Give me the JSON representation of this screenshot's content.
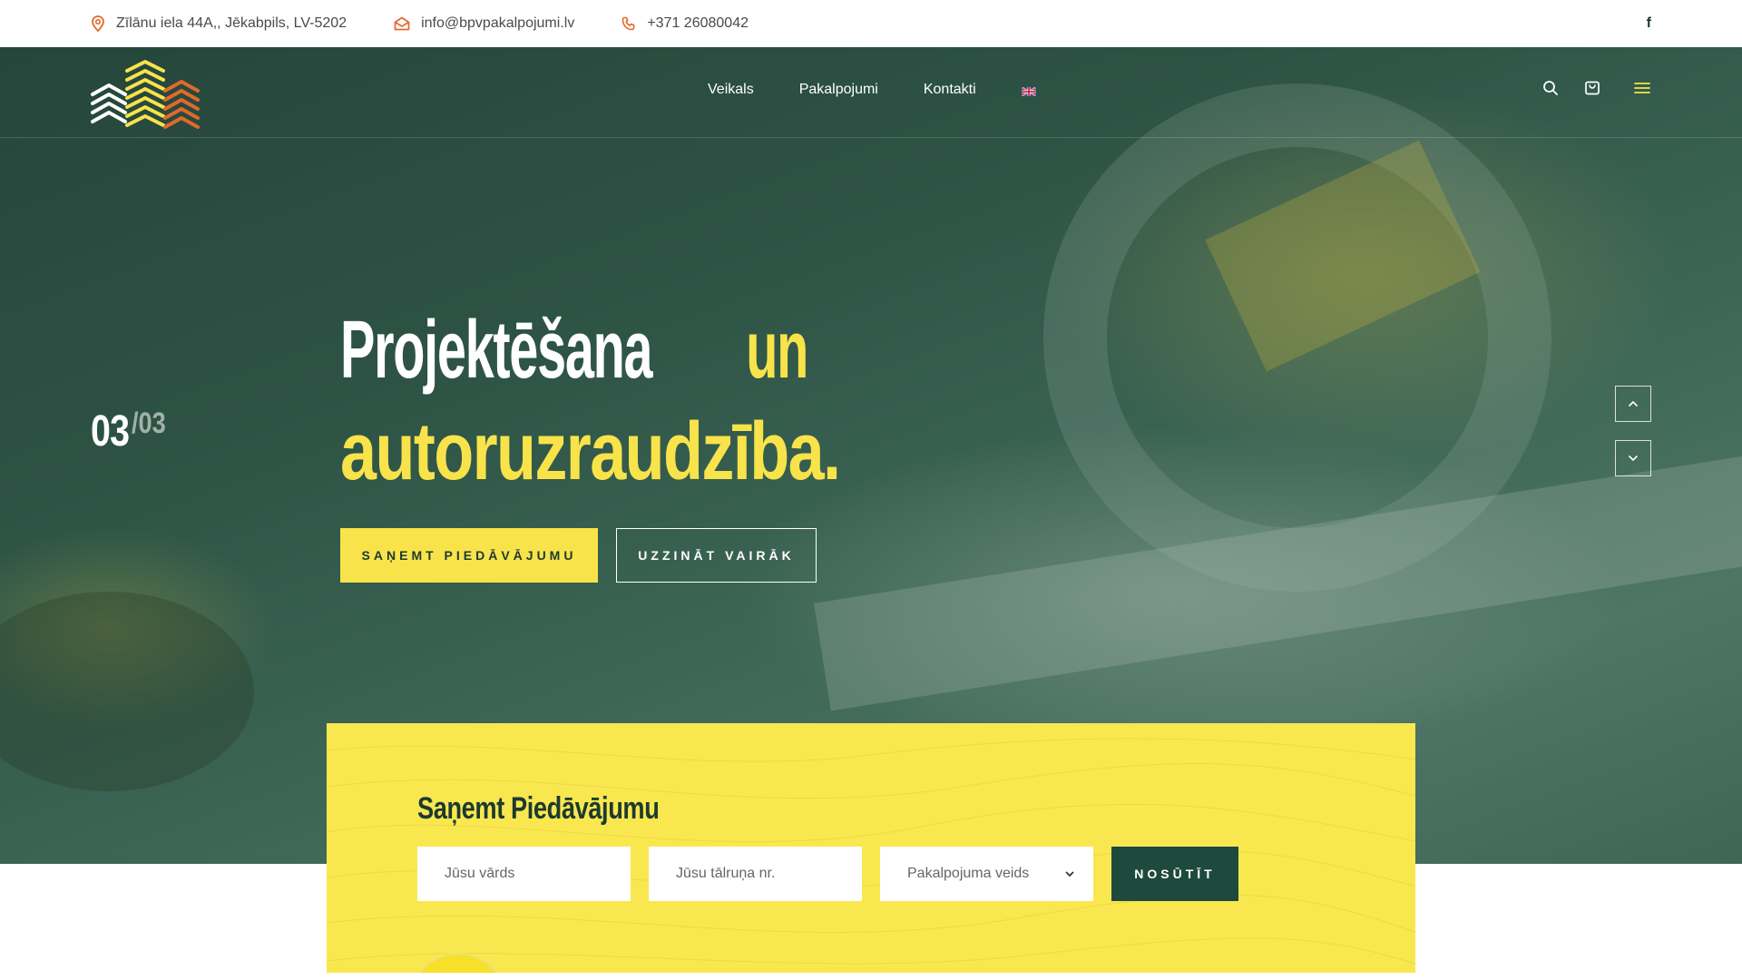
{
  "topbar": {
    "address": "Zīlānu iela 44A,, Jēkabpils, LV-5202",
    "email": "info@bpvpakalpojumi.lv",
    "phone": "+371 26080042",
    "social_icon": "facebook-icon",
    "social_label": "f"
  },
  "nav": {
    "items": [
      {
        "label": "Veikals"
      },
      {
        "label": "Pakalpojumi"
      },
      {
        "label": "Kontakti"
      }
    ],
    "language_icon": "uk-flag-icon"
  },
  "header_icons": [
    "search-icon",
    "cart-icon",
    "menu-icon"
  ],
  "hero": {
    "slide_current": "03",
    "slide_total": "/03",
    "headline_white": "Projektēšana",
    "headline_yellow_1": "un",
    "headline_yellow_2": "autoruzraudzība.",
    "primary_button": "SAŅEMT PIEDĀVĀJUMU",
    "secondary_button": "UZZINĀT VAIRĀK"
  },
  "quote_form": {
    "title": "Saņemt Piedāvājumu",
    "name_placeholder": "Jūsu vārds",
    "phone_placeholder": "Jūsu tālruņa nr.",
    "service_selected": "Pakalpojuma veids",
    "submit_label": "NOSŪTĪT"
  },
  "colors": {
    "accent_yellow": "#f8e34a",
    "dark_green": "#1d4a3c",
    "icon_orange": "#e2692a"
  }
}
